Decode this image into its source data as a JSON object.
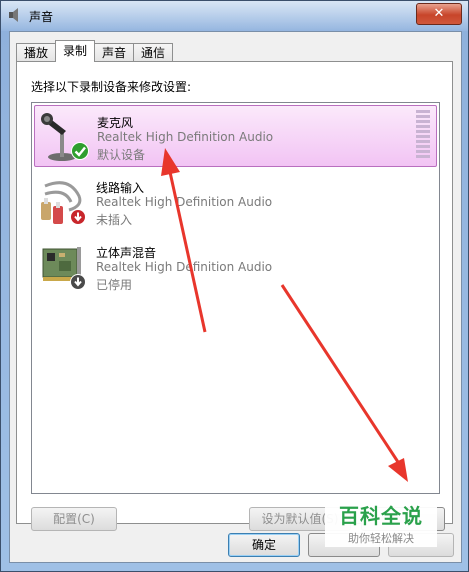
{
  "window": {
    "title": "声音",
    "close_glyph": "✕"
  },
  "tabs": [
    {
      "label": "播放",
      "active": false
    },
    {
      "label": "录制",
      "active": true
    },
    {
      "label": "声音",
      "active": false
    },
    {
      "label": "通信",
      "active": false
    }
  ],
  "instruction": "选择以下录制设备来修改设置:",
  "devices": [
    {
      "name": "麦克风",
      "driver": "Realtek High Definition Audio",
      "status": "默认设备",
      "icon": "microphone-icon",
      "badge": "green-check-icon",
      "selected": true
    },
    {
      "name": "线路输入",
      "driver": "Realtek High Definition Audio",
      "status": "未插入",
      "icon": "audio-cable-icon",
      "badge": "red-down-arrow-icon",
      "selected": false
    },
    {
      "name": "立体声混音",
      "driver": "Realtek High Definition Audio",
      "status": "已停用",
      "icon": "sound-card-icon",
      "badge": "gray-down-arrow-icon",
      "selected": false
    }
  ],
  "buttons": {
    "configure": "配置(C)",
    "set_default": "设为默认值(S)",
    "properties": "",
    "ok": "确定",
    "cancel": "",
    "apply": ""
  },
  "watermark": {
    "title": "百科全说",
    "subtitle": "助你轻松解决"
  },
  "colors": {
    "selection": "#f2c4f4",
    "annotation": "#e8362c",
    "watermark_green": "#2aa14b"
  }
}
